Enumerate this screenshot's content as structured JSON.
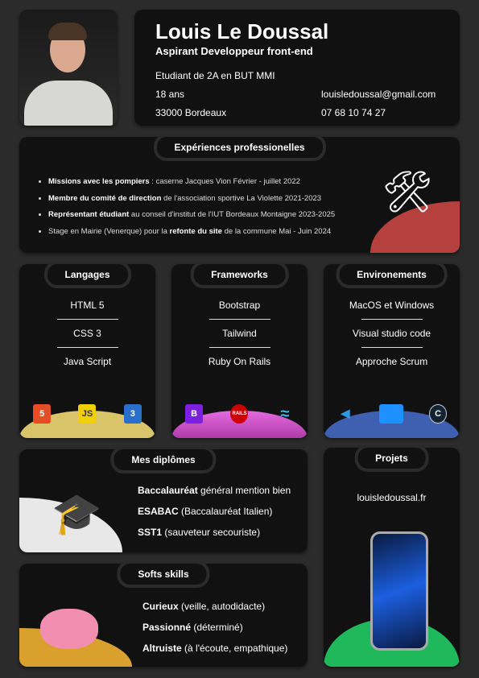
{
  "header": {
    "name": "Louis Le Doussal",
    "role": "Aspirant Developpeur front-end",
    "study": "Etudiant de 2A en BUT MMI",
    "age": "18 ans",
    "city": "33000 Bordeaux",
    "email": "louisledoussal@gmail.com",
    "phone": "07 68 10 74 27"
  },
  "experience": {
    "title": "Expériences professionelles",
    "items": [
      {
        "bold": "Missions avec les pompiers",
        "rest": " : caserne Jacques Vion Février - juillet 2022"
      },
      {
        "bold": "Membre du comité de direction",
        "rest": " de l'association sportive La Violette 2021-2023"
      },
      {
        "bold": "Représentant étudiant",
        "rest": " au conseil d'institut de l'IUT Bordeaux Montaigne  2023-2025"
      },
      {
        "pre": "Stage en Mairie (Venerque) pour la ",
        "bold": "refonte du site",
        "rest": " de la commune Mai - Juin 2024"
      }
    ]
  },
  "langages": {
    "title": "Langages",
    "items": [
      "HTML 5",
      "CSS 3",
      "Java Script"
    ],
    "icons": [
      "html5-icon",
      "js-icon",
      "css3-icon"
    ],
    "color": "#d9c46a"
  },
  "frameworks": {
    "title": "Frameworks",
    "items": [
      "Bootstrap",
      "Tailwind",
      "Ruby On Rails"
    ],
    "icons": [
      "bootstrap-icon",
      "rails-icon",
      "tailwind-icon"
    ],
    "color": "#d45cd0"
  },
  "environments": {
    "title": "Environements",
    "items": [
      "MacOS et Windows",
      "Visual studio code",
      "Approche Scrum"
    ],
    "icons": [
      "vscode-icon",
      "windows-apple-icon",
      "scrum-icon"
    ],
    "color": "#3f5fb0"
  },
  "diplomas": {
    "title": "Mes diplômes",
    "items": [
      {
        "bold": "Baccalauréat",
        "rest": "  général mention bien"
      },
      {
        "bold": "ESABAC",
        "rest": " (Baccalauréat Italien)"
      },
      {
        "bold": "SST1",
        "rest": " (sauveteur secouriste)"
      }
    ]
  },
  "softskills": {
    "title": "Softs skills",
    "items": [
      {
        "bold": "Curieux",
        "rest": " (veille, autodidacte)"
      },
      {
        "bold": "Passionné",
        "rest": " (déterminé)"
      },
      {
        "bold": "Altruiste",
        "rest": " (à l'écoute, empathique)"
      }
    ]
  },
  "projects": {
    "title": "Projets",
    "link": "louisledoussal.fr"
  },
  "colors": {
    "background": "#2c2b2b",
    "card": "#111111",
    "red": "#b5403d",
    "yellow": "#d9a02e",
    "green": "#1fb85a"
  }
}
